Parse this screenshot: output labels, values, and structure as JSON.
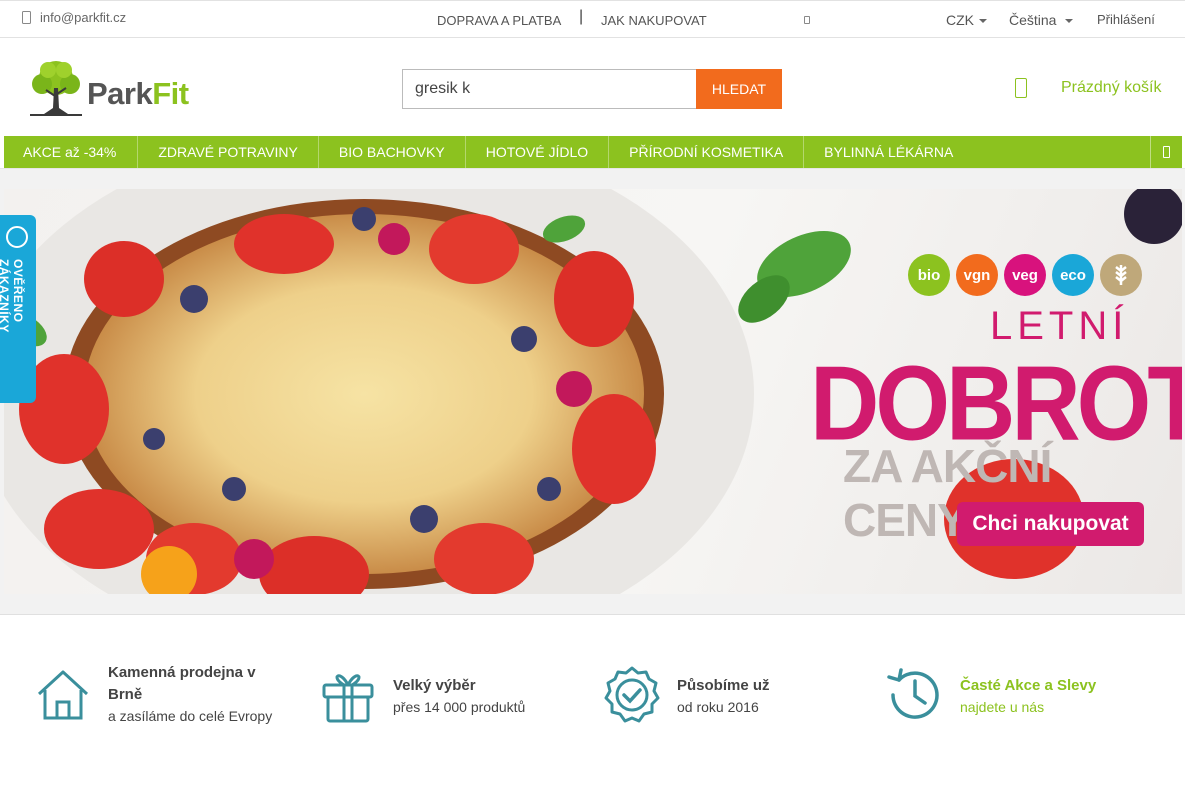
{
  "topbar": {
    "email": "info@parkfit.cz",
    "nav": [
      "DOPRAVA A PLATBA",
      "JAK NAKUPOVAT"
    ],
    "separator": "|",
    "currency": "CZK",
    "language": "Čeština",
    "login": "Přihlášení"
  },
  "header": {
    "logo_parts": [
      "Park",
      "Fit"
    ],
    "search": {
      "value": "gresik k",
      "button": "HLEDAT"
    },
    "cart_label": "Prázdný košík"
  },
  "menu": {
    "items": [
      "AKCE až -34%",
      "ZDRAVÉ POTRAVINY",
      "BIO BACHOVKY",
      "HOTOVÉ JÍDLO",
      "PŘÍRODNÍ KOSMETIKA",
      "BYLINNÁ LÉKÁRNA"
    ]
  },
  "banner": {
    "badges": [
      "bio",
      "vgn",
      "veg",
      "eco"
    ],
    "subtitle": "LETNÍ",
    "title": "DOBROTY",
    "subtitle2": "ZA AKČNÍ CENY",
    "cta": "Chci nakupovat"
  },
  "verified": {
    "label": "OVĚŘENO ZÁKAZNÍKY"
  },
  "features": [
    {
      "icon": "house-icon",
      "title": "Kamenná prodejna v Brně",
      "subtitle": "a zasíláme do celé Evropy"
    },
    {
      "icon": "gift-icon",
      "title": "Velký výběr",
      "subtitle": "přes 14 000 produktů"
    },
    {
      "icon": "certified-badge-icon",
      "title": "Působíme už",
      "subtitle": "od roku 2016"
    },
    {
      "icon": "history-clock-icon",
      "title": "Časté Akce a Slevy",
      "subtitle": "najdete u nás"
    }
  ],
  "colors": {
    "brand_green": "#8cc21f",
    "search_button": "#f26b1d",
    "promo_pink": "#d11b6e",
    "icon_teal": "#3a8f9c"
  }
}
